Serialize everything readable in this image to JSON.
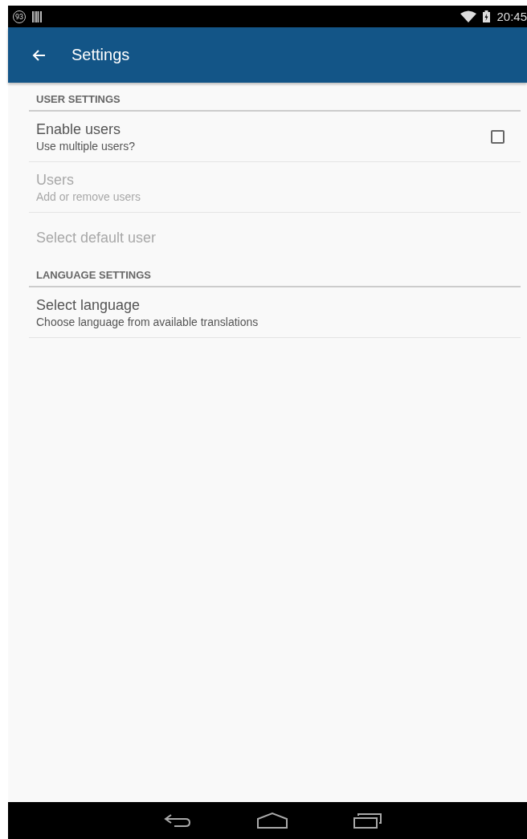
{
  "status_bar": {
    "notification_count": "93",
    "time": "20:45"
  },
  "app_bar": {
    "title": "Settings"
  },
  "sections": [
    {
      "header": "USER SETTINGS",
      "items": [
        {
          "kind": "checkbox",
          "title": "Enable users",
          "summary": "Use multiple users?",
          "disabled": false,
          "checked": false
        },
        {
          "kind": "plain",
          "title": "Users",
          "summary": "Add or remove users",
          "disabled": true
        },
        {
          "kind": "plain",
          "title": "Select default user",
          "disabled": true
        }
      ]
    },
    {
      "header": "LANGUAGE SETTINGS",
      "items": [
        {
          "kind": "plain",
          "title": "Select language",
          "summary": "Choose language from available translations",
          "disabled": false
        }
      ]
    }
  ]
}
